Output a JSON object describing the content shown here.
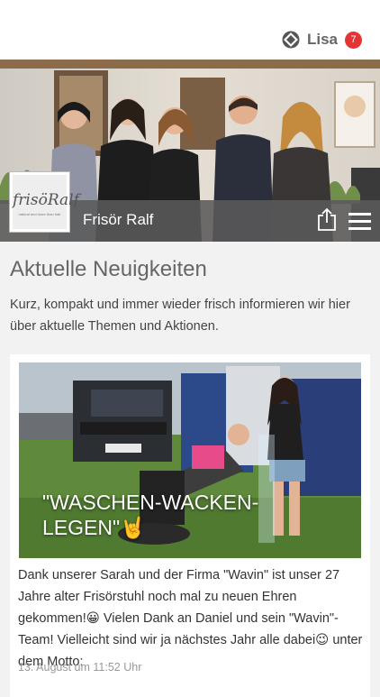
{
  "header": {
    "username": "Lisa",
    "notification_count": "7",
    "brand_icon": "diamond-logo-icon"
  },
  "salon": {
    "name": "Frisör Ralf",
    "logo_text": "frisöRalf",
    "logo_tagline": "natural and more than hair"
  },
  "actions": {
    "share_icon": "share-icon",
    "menu_icon": "hamburger-menu-icon"
  },
  "news": {
    "title": "Aktuelle Neuigkeiten",
    "intro": "Kurz, kompakt und immer wieder frisch informieren wir hier über aktuelle Themen und Aktionen."
  },
  "post": {
    "image_title": "\"WASCHEN-WACKEN-LEGEN\"🤘",
    "text": "Dank unserer Sarah und der Firma \"Wavin\" ist unser 27 Jahre alter Frisörstuhl noch mal zu neuen Ehren gekommen!😀 Vielen Dank an Daniel und sein \"Wavin\"-Team! Vielleicht sind wir ja nächstes Jahr alle dabei😉 unter dem Motto:",
    "date": "13. August um 11:52 Uhr"
  },
  "colors": {
    "badge": "#e53434",
    "salon_bar": "#5a5a5a",
    "background": "#f2f2f2"
  }
}
